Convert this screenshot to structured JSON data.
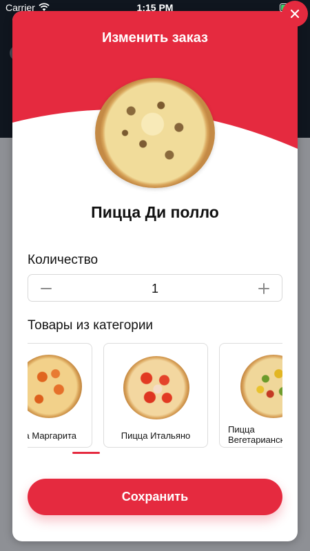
{
  "status_bar": {
    "carrier": "Carrier",
    "time": "1:15 PM",
    "battery_level": 1.0,
    "battery_color": "#3cd06b"
  },
  "modal": {
    "title": "Изменить заказ",
    "accent_color": "#e52a3f",
    "close_icon": "close-icon",
    "product": {
      "name": "Пицца Ди полло",
      "image_icon": "pizza-image"
    },
    "quantity": {
      "label": "Количество",
      "value": "1",
      "minus_icon": "minus-icon",
      "plus_icon": "plus-icon"
    },
    "category": {
      "label": "Товары из категории",
      "items": [
        {
          "label": "а Маргарита"
        },
        {
          "label": "Пицца Итальяно"
        },
        {
          "label_line1": "Пицца",
          "label_line2": "Вегетарианска"
        }
      ],
      "active_page_index": 0
    },
    "save_button": "Сохранить"
  }
}
